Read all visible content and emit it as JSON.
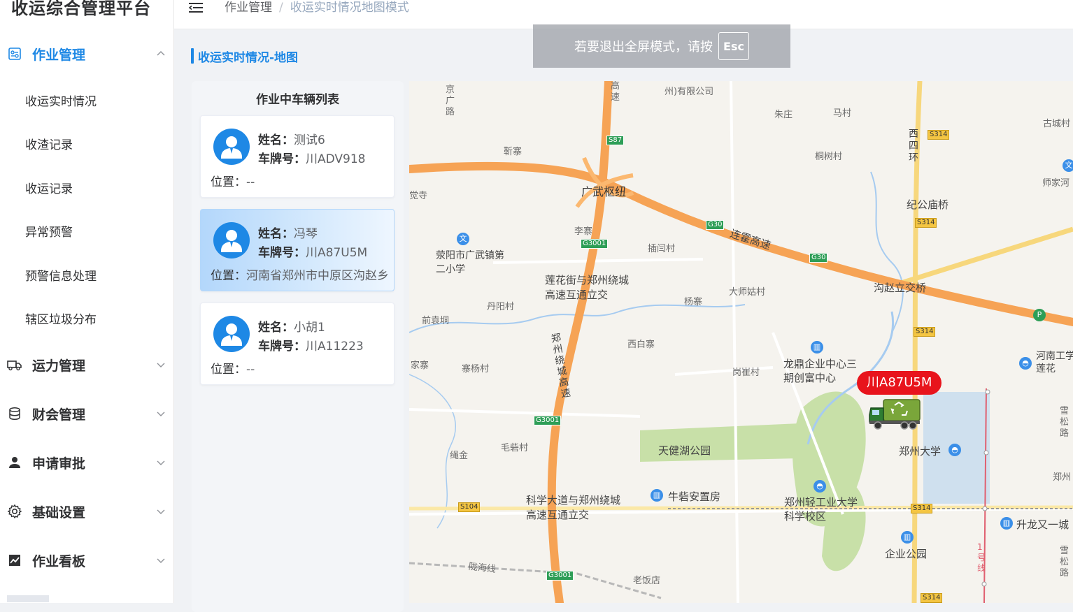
{
  "app": {
    "title": "收运综合管理平台"
  },
  "sidebar": {
    "groups": [
      {
        "label": "作业管理",
        "icon": "dashboard-icon",
        "expanded": true
      },
      {
        "label": "运力管理",
        "icon": "truck-icon",
        "expanded": false
      },
      {
        "label": "财会管理",
        "icon": "database-icon",
        "expanded": false
      },
      {
        "label": "申请审批",
        "icon": "user-icon",
        "expanded": false
      },
      {
        "label": "基础设置",
        "icon": "gear-icon",
        "expanded": false
      },
      {
        "label": "作业看板",
        "icon": "chart-icon",
        "expanded": false
      }
    ],
    "sub_items": [
      "收运实时情况",
      "收渣记录",
      "收运记录",
      "异常预警",
      "预警信息处理",
      "辖区垃圾分布"
    ]
  },
  "breadcrumb": {
    "items": [
      "作业管理",
      "收运实时情况地图模式"
    ]
  },
  "section": {
    "title": "收运实时情况-地图"
  },
  "fullscreen_toast": {
    "text": "若要退出全屏模式，请按",
    "key": "Esc"
  },
  "vehicle_panel": {
    "title": "作业中车辆列表",
    "name_label": "姓名：",
    "plate_label": "车牌号：",
    "location_label": "位置：",
    "vehicles": [
      {
        "name": "测试6",
        "plate": "川ADV918",
        "location": "--",
        "selected": false
      },
      {
        "name": "冯琴",
        "plate": "川A87U5M",
        "location": "河南省郑州市中原区沟赵乡",
        "selected": true
      },
      {
        "name": "小胡1",
        "plate": "川A11223",
        "location": "--",
        "selected": false
      }
    ]
  },
  "map": {
    "vehicle_tag": "川A87U5M",
    "labels": {
      "guangwu": "广武枢纽",
      "lianhuo": "连霍高速",
      "lianhua_jct": "莲花街与郑州绕城高速互通立交",
      "kexue_jct": "科学大道与郑州绕城高速互通立交",
      "gouzhao": "沟赵立交桥",
      "jigong": "纪公庙桥",
      "longding": "龙鼎企业中心三期创富中心",
      "tianjian": "天健湖公园",
      "zzu": "郑州大学",
      "zzuli": "郑州轻工业大学科学校区",
      "niuzhai": "牛砦安置房",
      "qiye": "企业公园",
      "shengl": "升龙又一城",
      "xingyang": "荥阳市广武镇第二小学",
      "raocheng": "郑州绕城高速",
      "longhai": "陇海线",
      "xisihuan": "西四环",
      "henan_gy": "河南工学莲花",
      "shijiahe": "师家河",
      "gucheng": "古城村",
      "zhuzhuang": "朱庄",
      "macun": "马村",
      "tongshu": "桐树村",
      "jinzhai": "靳寨",
      "lizhai": "李寨",
      "chachuang": "插闫村",
      "dashigu": "大师姑村",
      "yangzhai": "杨寨",
      "danyang": "丹阳村",
      "qianyuan": "前袁垌",
      "xibai": "西白寨",
      "gangcui": "岗崔村",
      "zhaiyang": "寨杨村",
      "shengjin": "绳金",
      "maozhai": "毛砦村",
      "laofan": "老饭店",
      "jiazhai": "家寨",
      "jue": "觉寺",
      "xuesong1": "雪松路",
      "xuesong2": "雪松路",
      "zhengzhou": "郑州",
      "line1": "1号线",
      "company": "州)有限公司",
      "jingguang": "京广路",
      "gaosu": "高速"
    },
    "shields": [
      "S87",
      "G30",
      "G30",
      "G3001",
      "G3001",
      "G3001",
      "S314",
      "S314",
      "S314",
      "S314",
      "S104",
      "S314"
    ]
  }
}
